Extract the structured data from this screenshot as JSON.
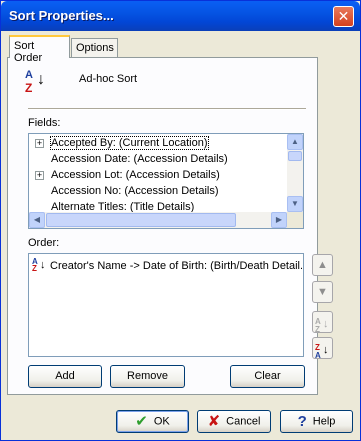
{
  "window": {
    "title": "Sort Properties...",
    "close_glyph": "✕"
  },
  "tabs": [
    {
      "label": "Sort Order",
      "active": true
    },
    {
      "label": "Options",
      "active": false
    }
  ],
  "header": {
    "label": "Ad-hoc Sort",
    "icon": "sort-az-icon"
  },
  "fields": {
    "label": "Fields:",
    "items": [
      {
        "label": "Accepted By: (Current Location)",
        "expandable": true,
        "selected": true
      },
      {
        "label": "Accession Date: (Accession Details)",
        "expandable": false
      },
      {
        "label": "Accession Lot: (Accession Details)",
        "expandable": true
      },
      {
        "label": "Accession No: (Accession Details)",
        "expandable": false
      },
      {
        "label": "Alternate Titles: (Title Details)",
        "expandable": false
      }
    ]
  },
  "order": {
    "label": "Order:",
    "items": [
      {
        "label": "Creator's Name -> Date of Birth: (Birth/Death Detail...",
        "direction": "descending"
      }
    ]
  },
  "list_buttons": {
    "add": "Add",
    "remove": "Remove",
    "clear": "Clear"
  },
  "side_buttons": {
    "up_glyph": "▲",
    "down_glyph": "▼"
  },
  "icon_text": {
    "a": "A",
    "z": "Z",
    "down_arrow": "↓"
  },
  "dialog_buttons": {
    "ok": "OK",
    "ok_glyph": "✔",
    "cancel": "Cancel",
    "cancel_glyph": "✘",
    "help": "Help",
    "help_glyph": "?"
  },
  "scroll_glyphs": {
    "up": "▲",
    "down": "▼",
    "left": "◀",
    "right": "▶",
    "plus": "+"
  },
  "colors": {
    "title_bar": "#0554E3",
    "window_bg": "#ECE9D8",
    "close_button": "#D5401E",
    "sort_a": "#1E3F9E",
    "sort_z": "#C81414"
  }
}
